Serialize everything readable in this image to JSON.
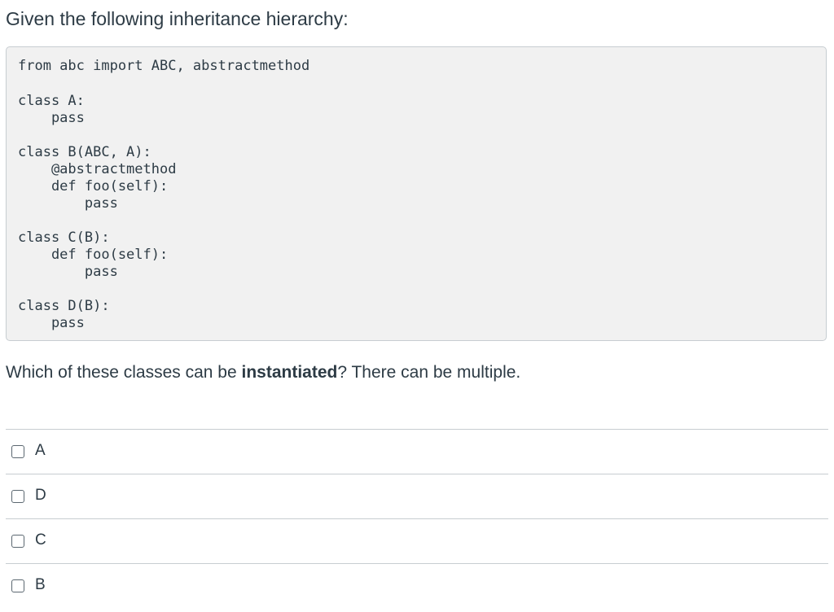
{
  "prompt": "Given the following inheritance hierarchy:",
  "code": {
    "lines": [
      "from abc import ABC, abstractmethod",
      "class A:",
      "    pass",
      "class B(ABC, A):",
      "    @abstractmethod",
      "    def foo(self):",
      "        pass",
      "class C(B):",
      "    def foo(self):",
      "        pass",
      "class D(B):",
      "    pass"
    ]
  },
  "question": {
    "before": "Which of these classes can be ",
    "emphasis": "instantiated",
    "after": "? There can be multiple."
  },
  "answers": [
    {
      "label": "A",
      "checked": false
    },
    {
      "label": "D",
      "checked": false
    },
    {
      "label": "C",
      "checked": false
    },
    {
      "label": "B",
      "checked": false
    }
  ]
}
